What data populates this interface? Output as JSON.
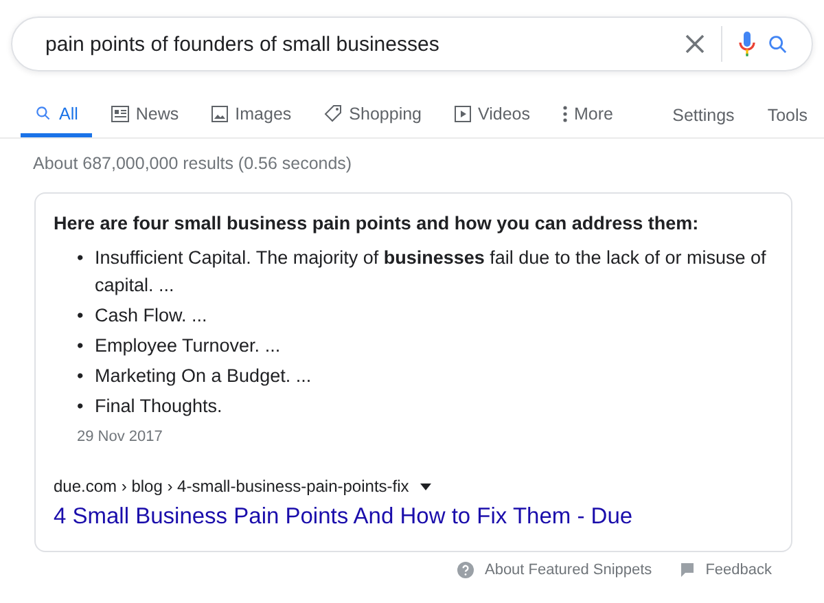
{
  "search": {
    "value": "pain points of founders of small businesses"
  },
  "tabs": [
    {
      "label": "All",
      "kind": "search",
      "selected": true
    },
    {
      "label": "News",
      "kind": "news",
      "selected": false
    },
    {
      "label": "Images",
      "kind": "image",
      "selected": false
    },
    {
      "label": "Shopping",
      "kind": "tag",
      "selected": false
    },
    {
      "label": "Videos",
      "kind": "play",
      "selected": false
    },
    {
      "label": "More",
      "kind": "dots",
      "selected": false
    }
  ],
  "tools": [
    "Settings",
    "Tools"
  ],
  "result_stats": "About 687,000,000 results (0.56 seconds)",
  "snippet": {
    "heading": "Here are four small business pain points and how you can address them:",
    "items": [
      {
        "marker": "•",
        "text": "Insufficient Capital. The majority of **businesses** fail due to the lack of or misuse of capital. ..."
      },
      {
        "marker": "•",
        "text": "Cash Flow. ..."
      },
      {
        "marker": "•",
        "text": "Employee Turnover. ..."
      },
      {
        "marker": "•",
        "text": "Marketing On a Budget. ..."
      },
      {
        "marker": "•",
        "text": "Final Thoughts."
      }
    ],
    "date": "29 Nov 2017",
    "breadcrumb": "due.com › blog › 4-small-business-pain-points-fix",
    "title": "4 Small Business Pain Points And How to Fix Them - Due"
  },
  "footer": [
    {
      "label": "About Featured Snippets",
      "kind": "help"
    },
    {
      "label": "Feedback",
      "kind": "flag"
    }
  ]
}
